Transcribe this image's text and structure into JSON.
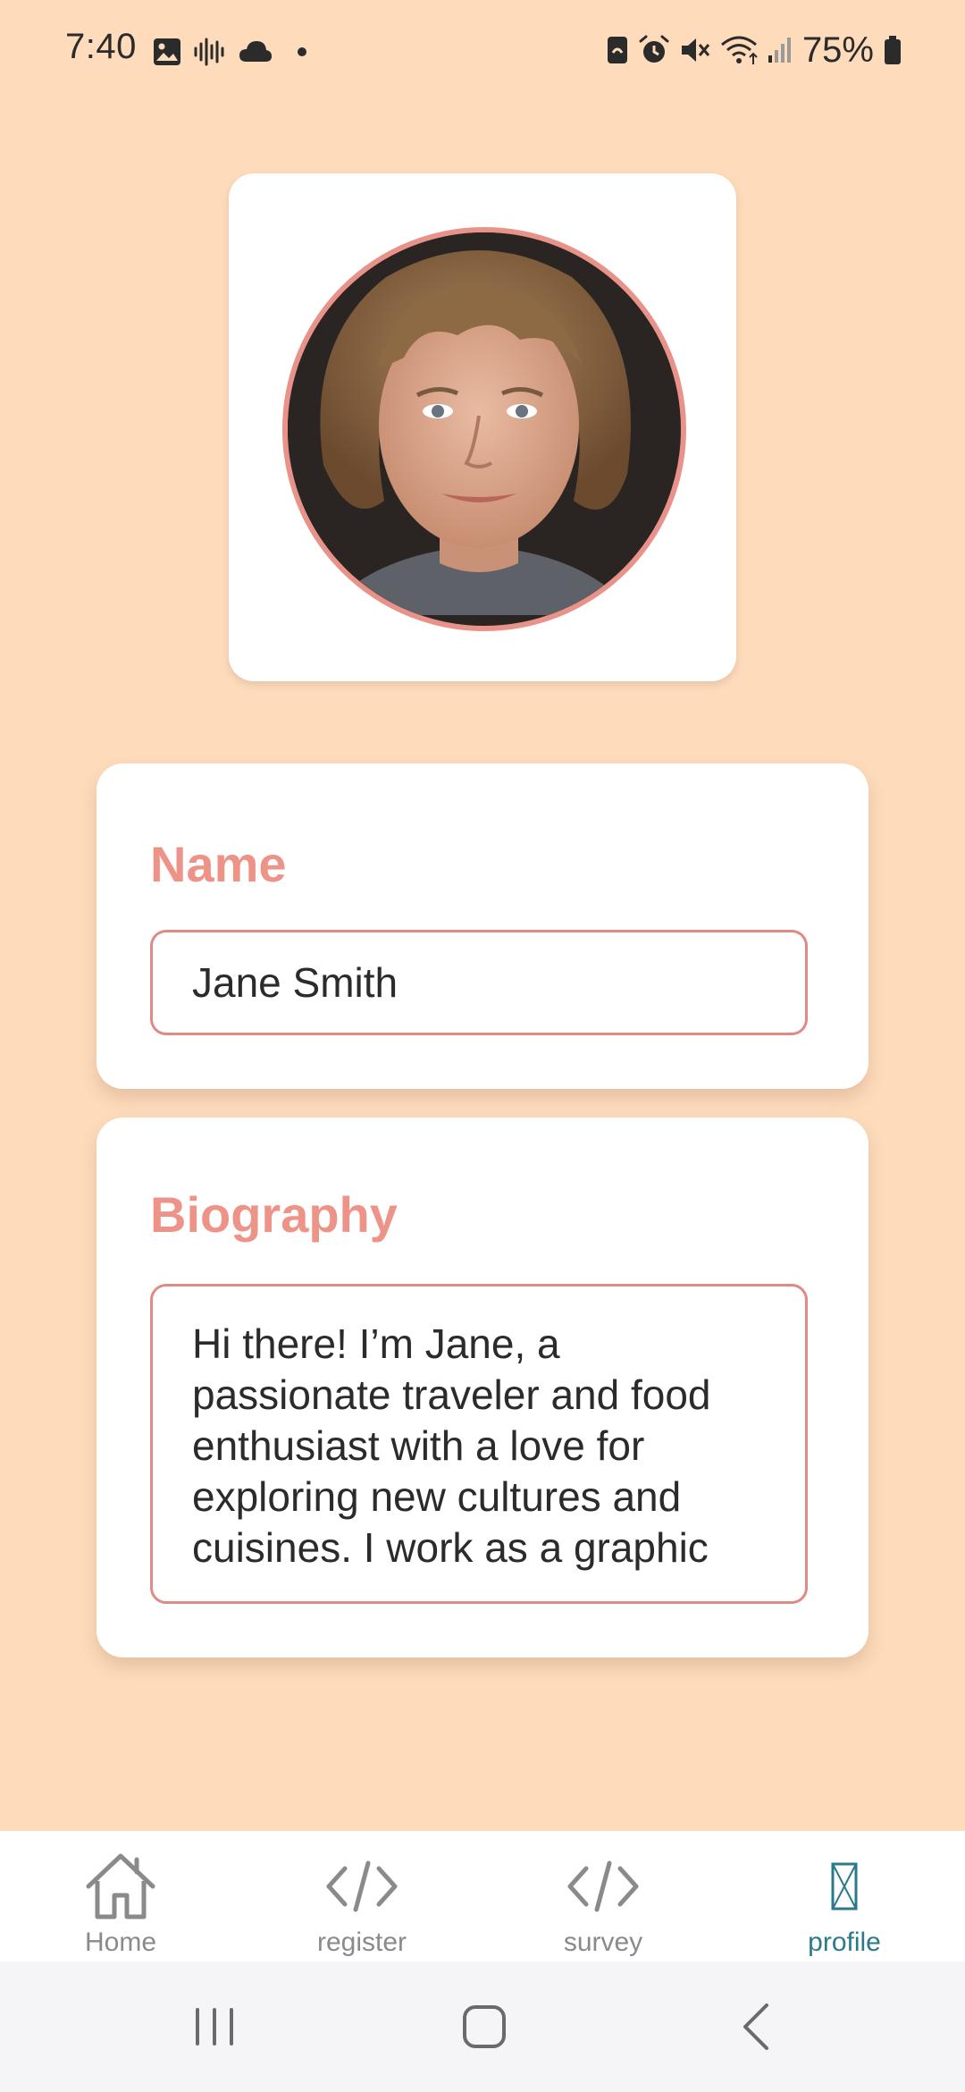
{
  "status_bar": {
    "time": "7:40",
    "battery": "75%",
    "left_icons": [
      "image-icon",
      "voice-recorder-icon",
      "cloud-icon",
      "dot-icon"
    ],
    "right_icons": [
      "app-lock-icon",
      "alarm-icon",
      "mute-icon",
      "wifi-icon",
      "signal-icon",
      "battery-icon"
    ]
  },
  "profile": {
    "avatar_icon": "profile-photo",
    "accent_color": "#EE9388"
  },
  "name_field": {
    "label": "Name",
    "value": "Jane Smith"
  },
  "bio_field": {
    "label": "Biography",
    "value": "Hi there! I’m Jane, a passionate traveler and food enthusiast with a love for exploring new cultures and cuisines. I work as a graphic"
  },
  "tab_bar": {
    "active_color": "#2A7A8C",
    "tabs": [
      {
        "label": "Home",
        "icon": "home-icon"
      },
      {
        "label": "register",
        "icon": "code-icon"
      },
      {
        "label": "survey",
        "icon": "code-icon"
      },
      {
        "label": "profile",
        "icon": "missing-glyph-icon",
        "active": true
      }
    ]
  },
  "system_nav": {
    "buttons": [
      "recent-apps-icon",
      "home-button-icon",
      "back-icon"
    ]
  }
}
